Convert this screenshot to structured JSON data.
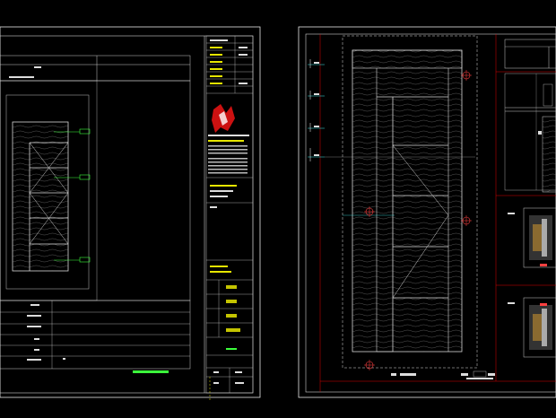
{
  "sheet_left": {
    "frame_color": "#e8e8e8",
    "inner_color": "#e60000",
    "door_callouts": [
      "",
      "",
      ""
    ],
    "table_left_labels": [
      "",
      "",
      "",
      "",
      "",
      ""
    ],
    "title_block": {
      "stamp_chars": [
        "",
        "",
        "",
        "",
        "",
        ""
      ],
      "bottom_label": ""
    }
  },
  "sheet_right": {
    "frame_color": "#e8e8e8",
    "inner_color": "#e60000"
  },
  "colors": {
    "wood_grain": "#7a7a7a",
    "door_panel": "#d0d0d0",
    "callout": "#3cff3c",
    "dim": "#40e8e8",
    "marker": "#ff4040",
    "logo": "#cc1111"
  }
}
